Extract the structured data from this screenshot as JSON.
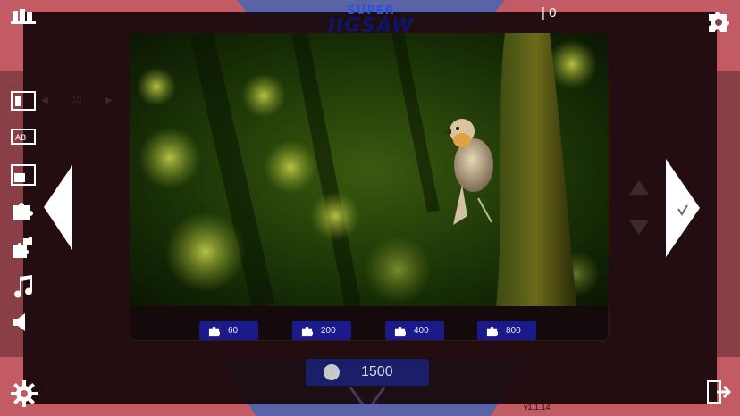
{
  "title": {
    "super": "SUPER",
    "jigsaw": "JIGSAW"
  },
  "top_score": "0",
  "pager": {
    "prev": "◀",
    "value": "10",
    "next": "▶"
  },
  "piece_options": [
    {
      "label": "60"
    },
    {
      "label": "200"
    },
    {
      "label": "400"
    },
    {
      "label": "800"
    }
  ],
  "coins": "1500",
  "version": "v1.1.14",
  "colors": {
    "background": "#c25b63",
    "panel": "#1a0a0d",
    "accent_blue": "#1b1a8a"
  },
  "icons": [
    "gallery-icon",
    "text-ab-icon",
    "layout-icon",
    "puzzle-piece-icon",
    "puzzle-pieces-icon",
    "music-icon",
    "speaker-icon",
    "gear-icon",
    "exit-icon",
    "settings-puzzle-icon"
  ]
}
